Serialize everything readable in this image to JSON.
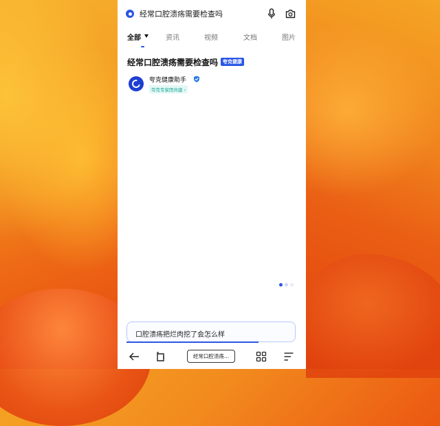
{
  "search": {
    "query": "经常口腔溃疡需要检查吗"
  },
  "tabs": [
    {
      "label": "全部",
      "active": true
    },
    {
      "label": "资讯",
      "active": false
    },
    {
      "label": "视频",
      "active": false
    },
    {
      "label": "文档",
      "active": false
    },
    {
      "label": "图片",
      "active": false
    }
  ],
  "result": {
    "title": "经常口腔溃疡需要检查吗",
    "badge": "夸克健康",
    "assistant_name": "夸克健康助手",
    "expert_tag": "夸克专家团共建 ›"
  },
  "suggestion": {
    "text": "口腔溃疡把烂肉挖了会怎么样",
    "progress": 0.78
  },
  "bottom_nav": {
    "tab_pill_label": "经常口腔溃疡..."
  },
  "pager": {
    "count": 3,
    "active_index": 0
  },
  "colors": {
    "accent": "#2a55e5",
    "tag_text": "#1aa89a",
    "tag_bg": "#e4f7f4"
  },
  "icons": [
    "quark-logo-icon",
    "mic-icon",
    "camera-icon",
    "chevron-down-icon",
    "verified-icon",
    "back-arrow-icon",
    "tab-switch-icon",
    "grid-icon",
    "menu-icon"
  ]
}
